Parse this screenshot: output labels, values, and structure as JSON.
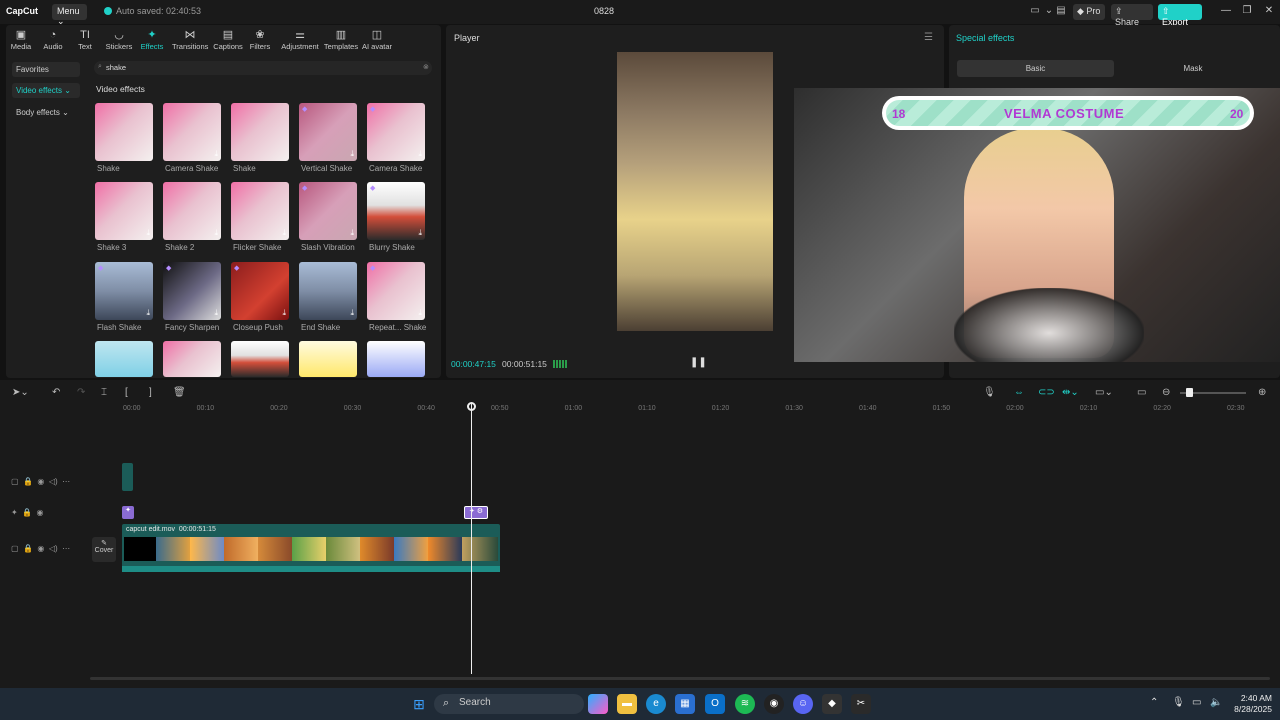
{
  "titlebar": {
    "logo": "CapCut",
    "menu_label": "Menu",
    "autosave": "Auto saved: 02:40:53",
    "project_title": "0828",
    "pro_label": "Pro",
    "share_label": "Share",
    "export_label": "Export"
  },
  "toolbar": {
    "tabs": [
      {
        "label": "Media",
        "icon": "▣"
      },
      {
        "label": "Audio",
        "icon": "◔"
      },
      {
        "label": "Text",
        "icon": "TI"
      },
      {
        "label": "Stickers",
        "icon": "◡"
      },
      {
        "label": "Effects",
        "icon": "✦"
      },
      {
        "label": "Transitions",
        "icon": "⋈"
      },
      {
        "label": "Captions",
        "icon": "▤"
      },
      {
        "label": "Filters",
        "icon": "❀"
      },
      {
        "label": "Adjustment",
        "icon": "⚌"
      },
      {
        "label": "Templates",
        "icon": "▥"
      },
      {
        "label": "AI avatar",
        "icon": "◫"
      }
    ]
  },
  "sidebar": {
    "items": [
      "Favorites",
      "Video effects",
      "Body effects"
    ]
  },
  "search": {
    "value": "shake"
  },
  "effects_section": {
    "title": "Video effects",
    "items": [
      {
        "label": "Shake"
      },
      {
        "label": "Camera Shake"
      },
      {
        "label": "Shake"
      },
      {
        "label": "Vertical Shake"
      },
      {
        "label": "Camera Shake"
      },
      {
        "label": "Shake 3"
      },
      {
        "label": "Shake 2"
      },
      {
        "label": "Flicker Shake"
      },
      {
        "label": "Slash Vibration"
      },
      {
        "label": "Blurry Shake"
      },
      {
        "label": "Flash Shake"
      },
      {
        "label": "Fancy Sharpen"
      },
      {
        "label": "Closeup Push"
      },
      {
        "label": "End Shake"
      },
      {
        "label": "Repeat... Shake"
      }
    ]
  },
  "player": {
    "title": "Player",
    "current_time": "00:00:47:15",
    "total_time": "00:00:51:15"
  },
  "right_panel": {
    "title": "Special effects",
    "tab_basic": "Basic",
    "tab_mask": "Mask"
  },
  "webcam_overlay": {
    "left_number": "18",
    "banner_text": "VELMA COSTUME",
    "right_number": "20"
  },
  "timeline": {
    "ruler": [
      "00:00",
      "00:10",
      "00:20",
      "00:30",
      "00:40",
      "00:50",
      "01:00",
      "01:10",
      "01:20",
      "01:30",
      "01:40",
      "01:50",
      "02:00",
      "02:10",
      "02:20",
      "02:30"
    ],
    "clip_name": "capcut edit.mov",
    "clip_duration": "00:00:51:15",
    "cover_label": "Cover"
  },
  "taskbar": {
    "search_placeholder": "Search",
    "time": "2:40 AM",
    "date": "8/28/2025"
  },
  "colors": {
    "accent": "#20d1c8",
    "effect_clip": "#8a6bd3",
    "panel": "#1e1e1e"
  }
}
